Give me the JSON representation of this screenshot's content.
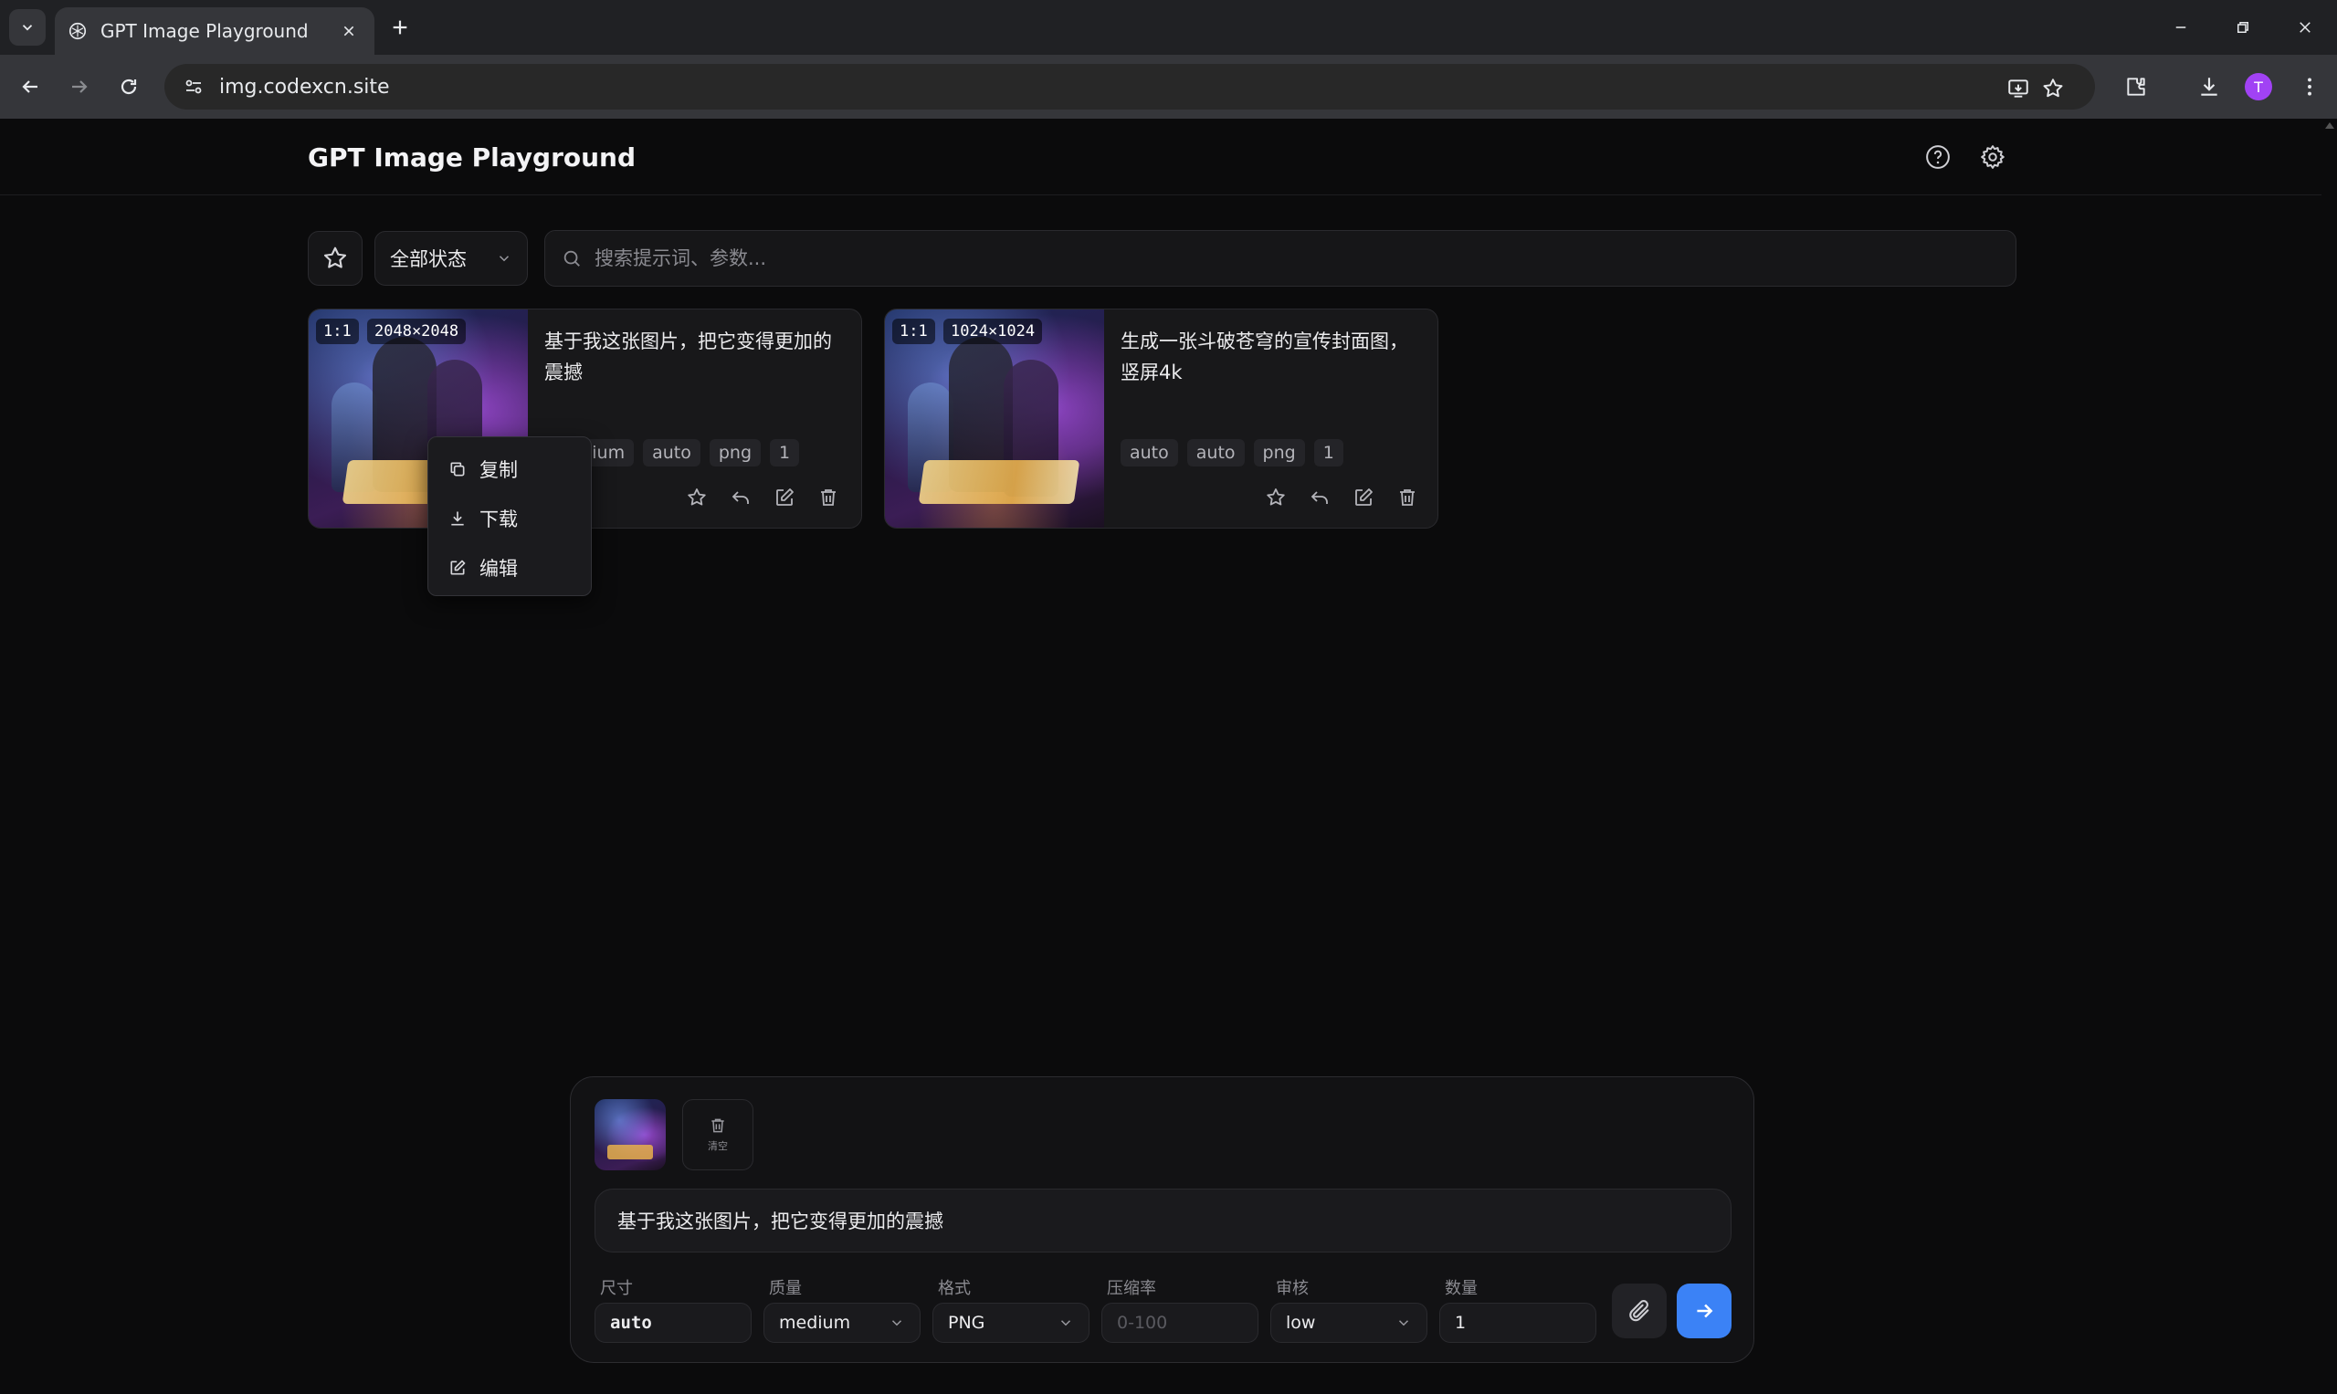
{
  "browser": {
    "tab_title": "GPT Image Playground",
    "url": "img.codexcn.site",
    "profile_initial": "T"
  },
  "app": {
    "title": "GPT Image Playground"
  },
  "filters": {
    "status_label": "全部状态",
    "search_placeholder": "搜索提示词、参数..."
  },
  "cards": [
    {
      "ratio": "1:1",
      "size": "2048×2048",
      "prompt": "基于我这张图片，把它变得更加的震撼",
      "tags": [
        "medium",
        "auto",
        "png",
        "1"
      ]
    },
    {
      "ratio": "1:1",
      "size": "1024×1024",
      "prompt": "生成一张斗破苍穹的宣传封面图，竖屏4k",
      "tags": [
        "auto",
        "auto",
        "png",
        "1"
      ]
    }
  ],
  "context_menu": {
    "items": [
      {
        "label": "复制",
        "icon": "copy-icon"
      },
      {
        "label": "下载",
        "icon": "download-icon"
      },
      {
        "label": "编辑",
        "icon": "edit-icon"
      }
    ]
  },
  "composer": {
    "clear_label": "清空",
    "prompt_text": "基于我这张图片，把它变得更加的震撼",
    "params": {
      "size": {
        "label": "尺寸",
        "value": "auto"
      },
      "quality": {
        "label": "质量",
        "value": "medium"
      },
      "format": {
        "label": "格式",
        "value": "PNG"
      },
      "compression": {
        "label": "压缩率",
        "placeholder": "0-100"
      },
      "moderation": {
        "label": "审核",
        "value": "low"
      },
      "count": {
        "label": "数量",
        "value": "1"
      }
    }
  },
  "colors": {
    "background": "#0b0b0c",
    "card": "#18181a",
    "accent": "#3b82f6",
    "profile": "#a142f4"
  }
}
